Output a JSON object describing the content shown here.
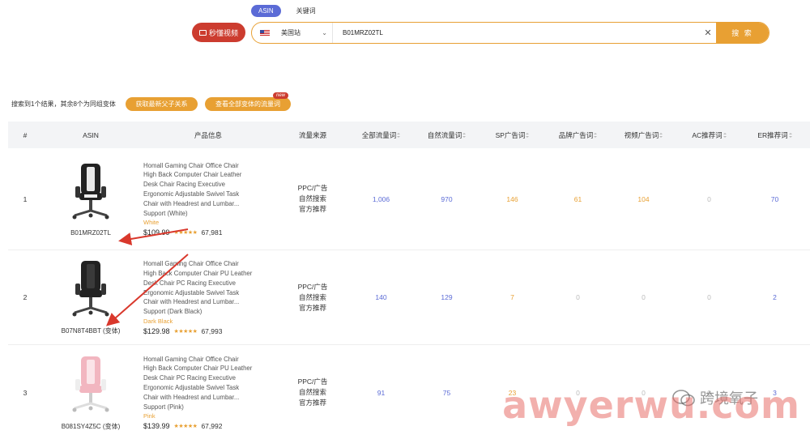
{
  "search": {
    "tabs": [
      {
        "label": "ASIN"
      },
      {
        "label": "关键词"
      }
    ],
    "video_button": "秒懂视频",
    "market": "美国站",
    "query": "B01MRZ02TL",
    "clear_glyph": "✕",
    "submit_label": "搜 索"
  },
  "summary": {
    "text": "搜索到1个结果，其余8个为同组变体",
    "btn_parent": "获取最新父子关系",
    "btn_variants": "查看全部变体的流量词",
    "new_badge": "new"
  },
  "table": {
    "headers": [
      "#",
      "ASIN",
      "产品信息",
      "流量来源",
      "全部流量词",
      "自然流量词",
      "SP广告词",
      "品牌广告词",
      "视频广告词",
      "AC推荐词",
      "ER推荐词"
    ],
    "rows": [
      {
        "index": "1",
        "asin": "B01MRZ02TL",
        "title_lines": [
          "Homall Gaming Chair Office Chair",
          "High Back Computer Chair Leather",
          "Desk Chair Racing Executive",
          "Ergonomic Adjustable Swivel Task",
          "Chair with Headrest and Lumbar...",
          "Support (White)"
        ],
        "variant": "White",
        "price": "$109.99",
        "stars": "★★★★★",
        "rating_count": "67,981",
        "sources": [
          "PPC/广告",
          "自然搜索",
          "官方推荐"
        ],
        "all": "1,006",
        "organic": "970",
        "sp": "146",
        "brand": "61",
        "video": "104",
        "ac": "0",
        "er": "70",
        "chair_color": "white"
      },
      {
        "index": "2",
        "asin": "B07N8T4BBT (变体)",
        "title_lines": [
          "Homall Gaming Chair Office Chair",
          "High Back Computer Chair PU Leather",
          "Desk Chair PC Racing Executive",
          "Ergonomic Adjustable Swivel Task",
          "Chair with Headrest and Lumbar...",
          "Support (Dark Black)"
        ],
        "variant": "Dark Black",
        "price": "$129.98",
        "stars": "★★★★★",
        "rating_count": "67,993",
        "sources": [
          "PPC/广告",
          "自然搜索",
          "官方推荐"
        ],
        "all": "140",
        "organic": "129",
        "sp": "7",
        "brand": "0",
        "video": "0",
        "ac": "0",
        "er": "2",
        "chair_color": "black"
      },
      {
        "index": "3",
        "asin": "B081SY4Z5C (变体)",
        "title_lines": [
          "Homall Gaming Chair Office Chair",
          "High Back Computer Chair PU Leather",
          "Desk Chair PC Racing Executive",
          "Ergonomic Adjustable Swivel Task",
          "Chair with Headrest and Lumbar...",
          "Support (Pink)"
        ],
        "variant": "Pink",
        "price": "$139.99",
        "stars": "★★★★★",
        "rating_count": "67,992",
        "sources": [
          "PPC/广告",
          "自然搜索",
          "官方推荐"
        ],
        "all": "91",
        "organic": "75",
        "sp": "23",
        "brand": "0",
        "video": "0",
        "ac": "0",
        "er": "3",
        "chair_color": "pink"
      }
    ]
  },
  "watermark": {
    "text": "awyerwu.com",
    "wechat_name": "跨境氧子"
  },
  "colors": {
    "accent": "#e8a033",
    "brand_blue": "#5b6bd6",
    "video_red": "#cc3c2f",
    "arrow": "#d9382c"
  }
}
